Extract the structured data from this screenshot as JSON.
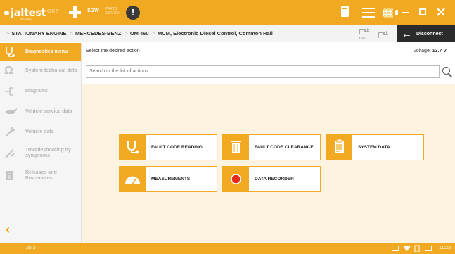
{
  "topbar": {
    "logo": "jaltest",
    "logo_sub": "by COJALI",
    "grp_label": "GRP",
    "sgw_label": "SGW",
    "parts_label": "PARTS SEARCH",
    "alert_label": "!",
    "help_label": "?"
  },
  "breadcrumb": {
    "items": [
      "STATIONARY ENGINE",
      "MERCEDES-BENZ",
      "OM 460",
      "MCM, Electronic Diesel Control, Common Rail"
    ]
  },
  "test_label": "TEST",
  "disconnect_label": "Disconnect",
  "sidebar": {
    "items": [
      {
        "label": "Diagnostics menu",
        "icon": "stethoscope-icon",
        "active": true
      },
      {
        "label": "System technical data",
        "icon": "omega-icon",
        "active": false
      },
      {
        "label": "Diagrams",
        "icon": "diagram-icon",
        "active": false
      },
      {
        "label": "Vehicle service data",
        "icon": "oil-can-icon",
        "active": false
      },
      {
        "label": "Vehicle data",
        "icon": "wrench-icon",
        "active": false
      },
      {
        "label": "Troubleshooting by symptoms",
        "icon": "troubleshooting-icon",
        "active": false
      },
      {
        "label": "Releases and Procedures",
        "icon": "procedures-icon",
        "active": false
      }
    ]
  },
  "main": {
    "hint": "Select the desired action",
    "voltage_label": "Voltage:",
    "voltage_value": "13.7 V",
    "search_placeholder": "Search in the list of actions",
    "actions": [
      {
        "label": "FAULT CODE READING",
        "icon": "stethoscope-icon"
      },
      {
        "label": "FAULT CODE CLEARANCE",
        "icon": "trash-icon"
      },
      {
        "label": "SYSTEM DATA",
        "icon": "clipboard-icon"
      },
      {
        "label": "MEASUREMENTS",
        "icon": "gauge-icon"
      },
      {
        "label": "DATA RECORDER",
        "icon": "record-icon"
      }
    ]
  },
  "status": {
    "version": "25.3",
    "time": "11:23"
  },
  "colors": {
    "accent": "#f0a920",
    "dark": "#2b2b2b",
    "workarea": "#fdf3e0"
  }
}
